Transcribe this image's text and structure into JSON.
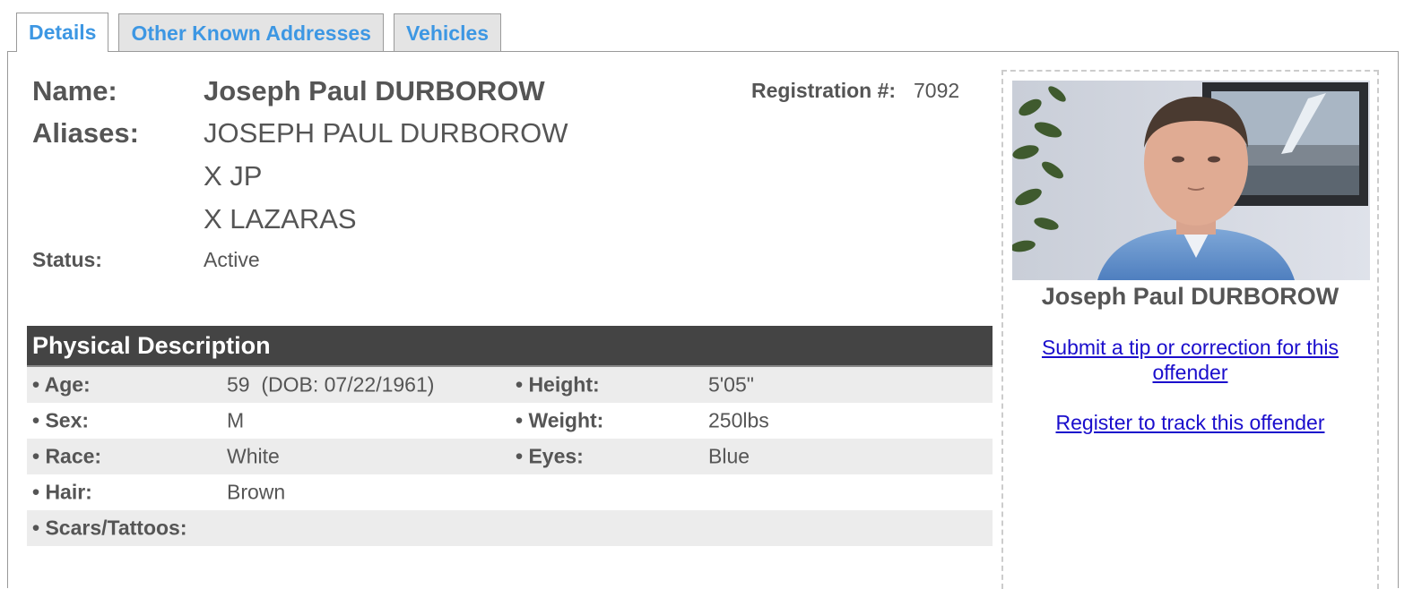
{
  "tabs": [
    {
      "label": "Details"
    },
    {
      "label": "Other Known Addresses"
    },
    {
      "label": "Vehicles"
    }
  ],
  "details": {
    "name_label": "Name:",
    "name": "Joseph Paul DURBOROW",
    "aliases_label": "Aliases:",
    "aliases": [
      "JOSEPH PAUL DURBOROW",
      "X JP",
      "X LAZARAS"
    ],
    "status_label": "Status:",
    "status": "Active",
    "registration_label": "Registration #:",
    "registration": "7092"
  },
  "physical": {
    "title": "Physical Description",
    "age_label": "• Age:",
    "age": "59  (DOB: 07/22/1961)",
    "height_label": "• Height:",
    "height": "5'05\"",
    "sex_label": "• Sex:",
    "sex": "M",
    "weight_label": "• Weight:",
    "weight": "250lbs",
    "race_label": "• Race:",
    "race": "White",
    "eyes_label": "• Eyes:",
    "eyes": "Blue",
    "hair_label": "• Hair:",
    "hair": "Brown",
    "scars_label": "• Scars/Tattoos:",
    "scars": ""
  },
  "sidebar": {
    "name": "Joseph Paul DURBOROW",
    "tip_link": "Submit a tip or correction for this offender",
    "register_link": "Register to track this offender"
  },
  "colors": {
    "tab_text": "#3d97e3",
    "header_bg": "#444444",
    "link": "#1a0dcc"
  }
}
